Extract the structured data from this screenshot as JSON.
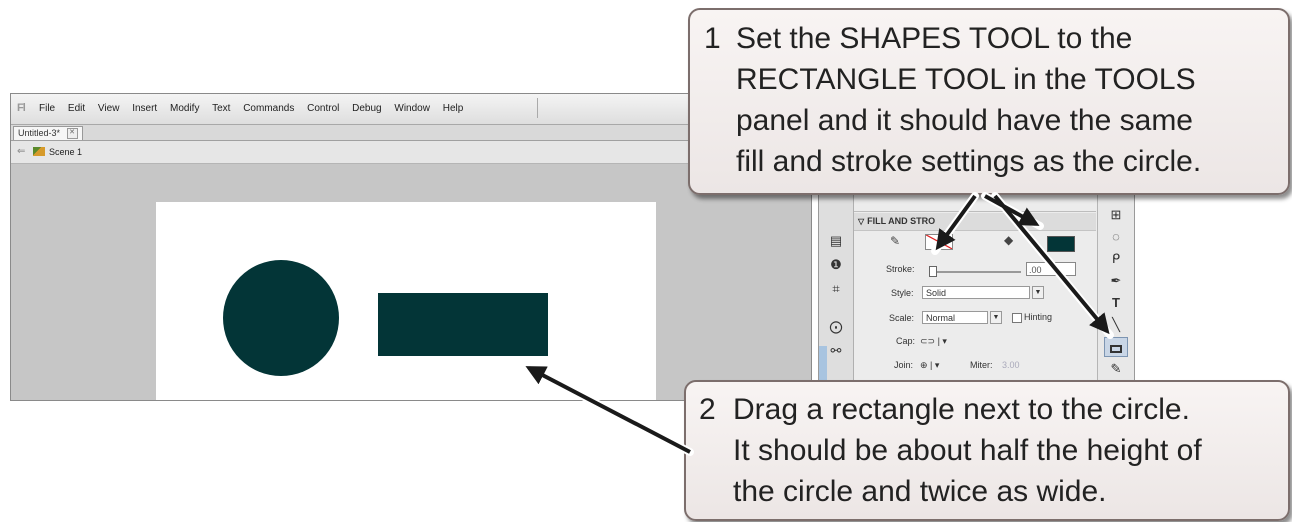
{
  "app": {
    "logo": "Fl",
    "menus": [
      "File",
      "Edit",
      "View",
      "Insert",
      "Modify",
      "Text",
      "Commands",
      "Control",
      "Debug",
      "Window",
      "Help"
    ],
    "doc_tab": "Untitled-3*",
    "scene": "Scene 1"
  },
  "stage": {
    "shape_color": "#033537",
    "stage_color": "#ffffff"
  },
  "properties": {
    "section_title": "FILL AND STRO",
    "stroke_label": "Stroke:",
    "stroke_value": ".00",
    "style_label": "Style:",
    "style_value": "Solid",
    "scale_label": "Scale:",
    "scale_value": "Normal",
    "hinting_label": "Hinting",
    "cap_label": "Cap:",
    "join_label": "Join:",
    "miter_label": "Miter:",
    "miter_value": "3.00",
    "fill_color": "#033537",
    "stroke_color": "#dd2222"
  },
  "callout_1": {
    "number": "1",
    "text": "Set the SHAPES TOOL to the\nRECTANGLE TOOL in the TOOLS\npanel and it should have the same\nfill and stroke settings as the circle."
  },
  "callout_2": {
    "number": "2",
    "text": "Drag a rectangle next to the circle.\nIt should be about half the height of\nthe circle and twice as wide."
  }
}
